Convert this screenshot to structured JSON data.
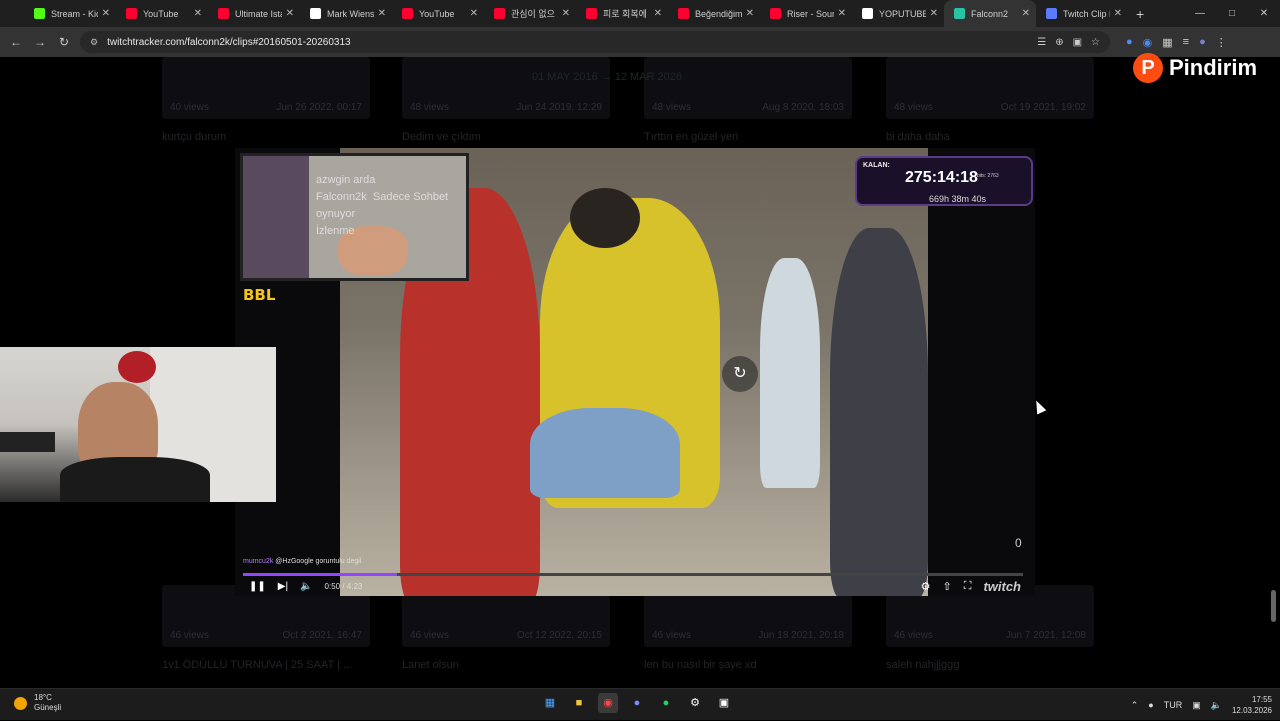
{
  "browser": {
    "tabs": [
      {
        "label": "Stream - Kick",
        "color": "#53fc18"
      },
      {
        "label": "YouTube",
        "color": "#ff0033"
      },
      {
        "label": "Ultimate Istan",
        "color": "#ff0033"
      },
      {
        "label": "Mark Wiens",
        "color": "#ffffff"
      },
      {
        "label": "YouTube",
        "color": "#ff0033"
      },
      {
        "label": "관심이 없으",
        "color": "#ff0033"
      },
      {
        "label": "피로 회복에",
        "color": "#ff0033"
      },
      {
        "label": "Beğendiğim",
        "color": "#ff0033"
      },
      {
        "label": "Riser - Sound",
        "color": "#ff0033"
      },
      {
        "label": "YOPUTUBE",
        "color": "#ffffff"
      },
      {
        "label": "Falconn2",
        "color": "#27c3a5",
        "active": true
      },
      {
        "label": "Twitch Clip D",
        "color": "#5a7bff"
      }
    ],
    "new_tab": "+",
    "url": "twitchtracker.com/falconn2k/clips#20160501-20260313"
  },
  "clips_grid": {
    "top_row": [
      {
        "views": "40 views",
        "date": "Jun 26 2022, 00:17",
        "title": "kurtçu durum"
      },
      {
        "views": "48 views",
        "date": "Jun 24 2019, 12:29",
        "title": "Dedim ve çıktım"
      },
      {
        "views": "48 views",
        "date": "Aug 8 2020, 18:03",
        "title": "Tırttın en güzel yeri"
      },
      {
        "views": "48 views",
        "date": "Oct 19 2021, 19:02",
        "title": "bi daha daha"
      }
    ],
    "banner": "01 MAY 2016 → 12 MAR 2026",
    "bottom_row": [
      {
        "views": "46 views",
        "date": "Oct 2 2021, 16:47",
        "title": "1v1 ÖDÜLLÜ TURNUVA | 25 SAAT | ..."
      },
      {
        "views": "46 views",
        "date": "Oct 12 2022, 20:15",
        "title": "Lanet olsun"
      },
      {
        "views": "46 views",
        "date": "Jun 18 2021, 20:18",
        "title": "len bu nasıl bir şaye xd"
      },
      {
        "views": "46 views",
        "date": "Jun 7 2021, 12:08",
        "title": "saleh nahjjjggg"
      }
    ]
  },
  "player": {
    "cam_overlay": {
      "name": "azwgin arda",
      "line1": "Falconn2k",
      "line2": "Sadece Sohbet oynuyor",
      "line3": "İzlenme"
    },
    "bbl_badge": "BBL",
    "timer": {
      "label": "KALAN:",
      "time": "275:14:18",
      "sub": "669h 38m 40s",
      "tiny": "bits: 2763"
    },
    "chat": {
      "user": "mumcu2k",
      "message": "@HzGoogle goruntulu degil"
    },
    "progress": 0.1976,
    "time_current": "0:50",
    "time_total": "4:23",
    "viewer_count": "0",
    "brand": "twitch"
  },
  "pindirim": {
    "logo": "P",
    "name": "Pindirim"
  },
  "taskbar": {
    "temp": "18°C",
    "weather": "Güneşli",
    "lang": "TUR",
    "time": "17:55",
    "date": "12.03.2026"
  }
}
